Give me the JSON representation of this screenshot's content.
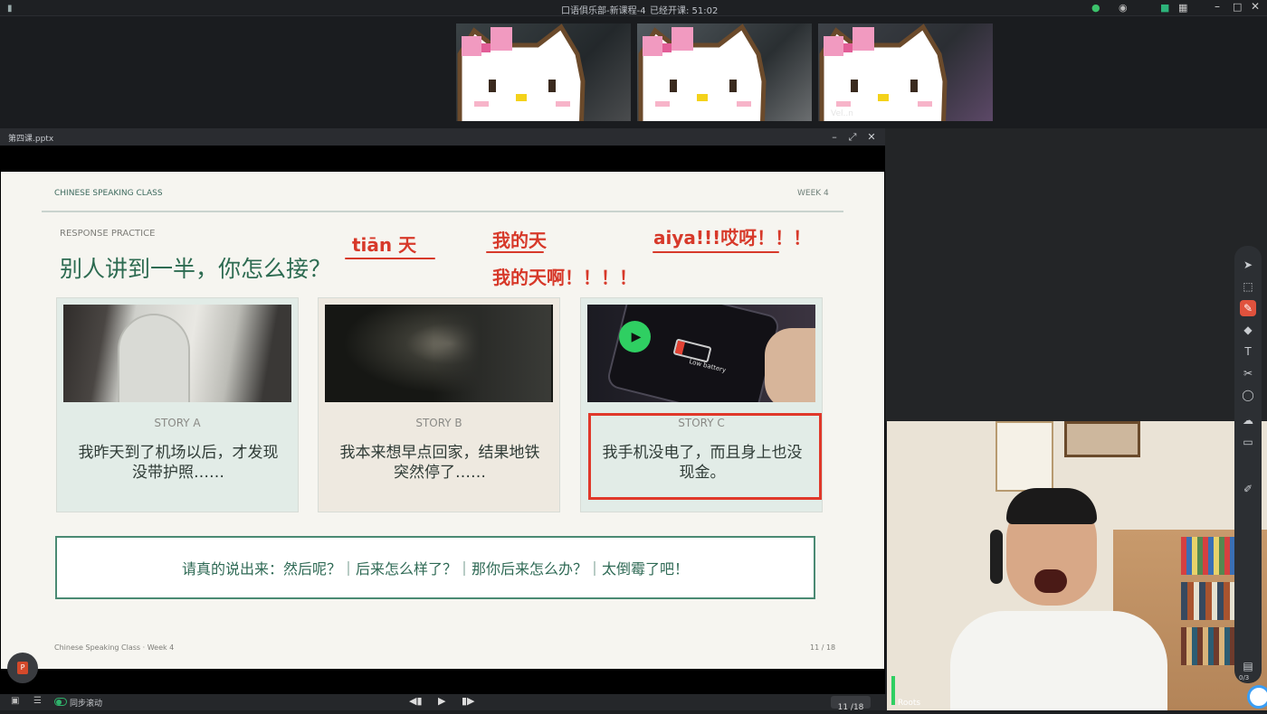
{
  "topbar": {
    "title": "口语俱乐部-新课程-4",
    "elapsed": "已经开课: 51:02"
  },
  "videos": [
    {
      "name": ""
    },
    {
      "name": ""
    },
    {
      "name": "Vel..n"
    }
  ],
  "ppt": {
    "filename": "第四课.pptx",
    "header_left": "CHINESE SPEAKING CLASS",
    "header_right": "WEEK 4",
    "section": "RESPONSE PRACTICE",
    "question": "别人讲到一半，你怎么接？",
    "annotations": [
      "tiān 天",
      "我的天",
      "我的天啊！！！！",
      "aiya!!!哎呀！！！"
    ],
    "stories": [
      {
        "label": "STORY A",
        "text": "我昨天到了机场以后，才发现没带护照……",
        "color": "#e2ece7"
      },
      {
        "label": "STORY B",
        "text": "我本来想早点回家，结果地铁突然停了……",
        "color": "#eee9e0"
      },
      {
        "label": "STORY C",
        "text": "我手机没电了，而且身上也没现金。",
        "color": "#e2ece7",
        "photo_text": "Low battery"
      }
    ],
    "prompt": "请真的说出来：然后呢？｜后来怎么样了？｜那你后来怎么办？｜太倒霉了吧！",
    "footer_left": "Chinese Speaking Class · Week 4",
    "footer_right": "11 / 18"
  },
  "bottombar": {
    "sync": "同步滚动",
    "page": "11 /18"
  },
  "camera": {
    "name": "Roots"
  },
  "tools": {
    "page_count": "0/3"
  }
}
